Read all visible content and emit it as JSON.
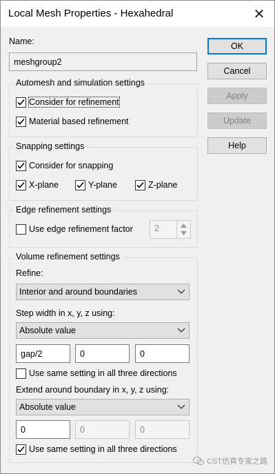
{
  "window": {
    "title": "Local Mesh Properties - Hexahedral",
    "close_glyph": "✕"
  },
  "name": {
    "label": "Name:",
    "value": "meshgroup2"
  },
  "buttons": {
    "ok": "OK",
    "cancel": "Cancel",
    "apply": "Apply",
    "update": "Update",
    "help": "Help"
  },
  "automesh": {
    "title": "Automesh and simulation settings",
    "consider_refinement": {
      "label": "Consider for refinement",
      "checked": true
    },
    "material_refinement": {
      "label": "Material based refinement",
      "checked": true
    }
  },
  "snapping": {
    "title": "Snapping settings",
    "consider_snapping": {
      "label": "Consider for snapping",
      "checked": true
    },
    "x_plane": {
      "label": "X-plane",
      "checked": true
    },
    "y_plane": {
      "label": "Y-plane",
      "checked": true
    },
    "z_plane": {
      "label": "Z-plane",
      "checked": true
    }
  },
  "edge": {
    "title": "Edge refinement settings",
    "use_factor": {
      "label": "Use edge refinement factor",
      "checked": false
    },
    "factor_value": "2"
  },
  "volume": {
    "title": "Volume refinement settings",
    "refine_label": "Refine:",
    "refine_value": "Interior and around boundaries",
    "step_label": "Step width in x, y, z using:",
    "step_mode": "Absolute value",
    "step_x": "gap/2",
    "step_y": "0",
    "step_z": "0",
    "step_same": {
      "label": "Use same setting in all three directions",
      "checked": false
    },
    "extend_label": "Extend around boundary in x, y, z using:",
    "extend_mode": "Absolute value",
    "extend_x": "0",
    "extend_y": "0",
    "extend_z": "0",
    "extend_same": {
      "label": "Use same setting in all three directions",
      "checked": true
    }
  },
  "watermark": {
    "text": "CST仿真专家之路"
  }
}
